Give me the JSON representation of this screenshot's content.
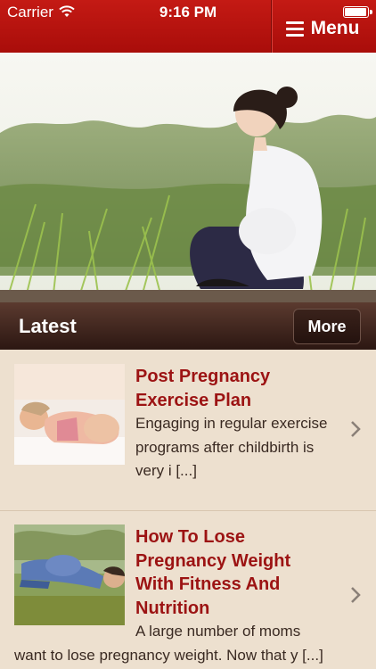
{
  "status_bar": {
    "carrier": "Carrier",
    "time": "9:16 PM"
  },
  "nav": {
    "menu_label": "Menu"
  },
  "colors": {
    "brand_red": "#b0100c",
    "title_red": "#9c1313",
    "section_bar": "#3c2119",
    "list_bg": "#ede0cf"
  },
  "section": {
    "title": "Latest",
    "more_label": "More"
  },
  "articles": [
    {
      "title_lines": [
        "Post Pregnancy",
        "Exercise Plan"
      ],
      "excerpt_lines": [
        "Engaging in regular exercise",
        "programs after childbirth is",
        "very i [...]"
      ]
    },
    {
      "title_lines": [
        "How To Lose",
        "Pregnancy Weight",
        "With Fitness And",
        "Nutrition"
      ],
      "excerpt_lines": [
        "A large number of moms",
        "want to lose pregnancy weight. Now that y [...]"
      ]
    }
  ]
}
